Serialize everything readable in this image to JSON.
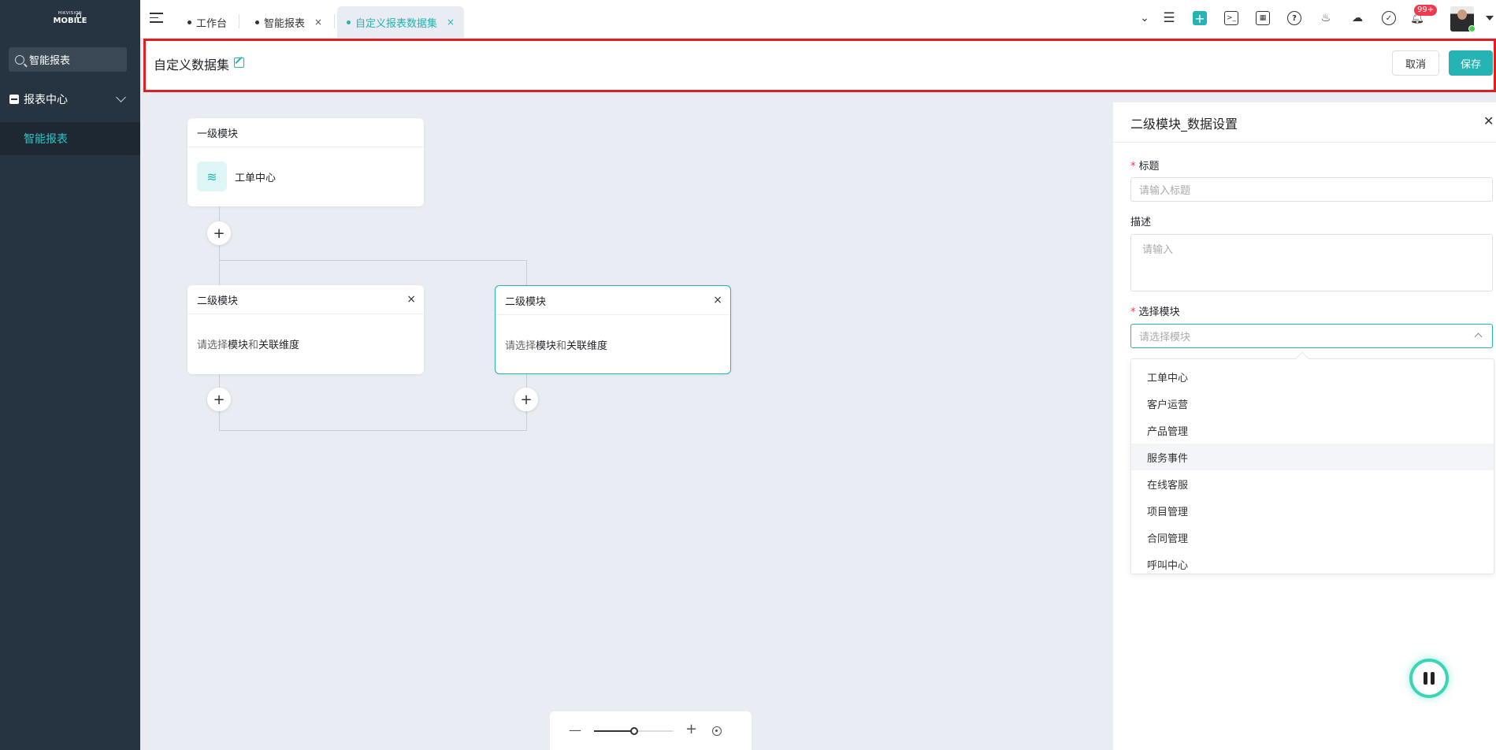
{
  "sidebar": {
    "logo_small": "HIKVISION",
    "logo_big": "MOBILE",
    "search_value": "智能报表",
    "group_label": "报表中心",
    "active_item": "智能报表"
  },
  "topbar": {
    "tabs": [
      {
        "label": "工作台"
      },
      {
        "label": "智能报表",
        "close": "×"
      },
      {
        "label": "自定义报表数据集",
        "close": "×"
      }
    ],
    "notification_badge": "99+"
  },
  "header": {
    "title": "自定义数据集",
    "cancel_label": "取消",
    "save_label": "保存"
  },
  "canvas": {
    "level1": {
      "head": "一级模块",
      "module": "工单中心"
    },
    "level2": [
      {
        "head": "二级模块",
        "prompt_a": "请选择",
        "prompt_b": "模块",
        "prompt_c": "和",
        "prompt_d": "关联维度"
      },
      {
        "head": "二级模块",
        "prompt_a": "请选择",
        "prompt_b": "模块",
        "prompt_c": "和",
        "prompt_d": "关联维度"
      }
    ],
    "add_symbol": "+",
    "close_symbol": "×"
  },
  "zoom": {
    "minus": "—",
    "plus": "+"
  },
  "panel": {
    "title": "二级模块_数据设置",
    "title_field": {
      "label": "标题",
      "placeholder": "请输入标题"
    },
    "desc_field": {
      "label": "描述",
      "placeholder": "请输入"
    },
    "module_field": {
      "label": "选择模块",
      "placeholder": "请选择模块"
    },
    "options": [
      "工单中心",
      "客户运营",
      "产品管理",
      "服务事件",
      "在线客服",
      "项目管理",
      "合同管理",
      "呼叫中心"
    ],
    "hovered_option": "服务事件"
  },
  "colors": {
    "accent": "#25b3b3",
    "sidebar_bg": "#263340",
    "canvas_bg": "#e9ecf2",
    "highlight_border": "#e02020"
  }
}
